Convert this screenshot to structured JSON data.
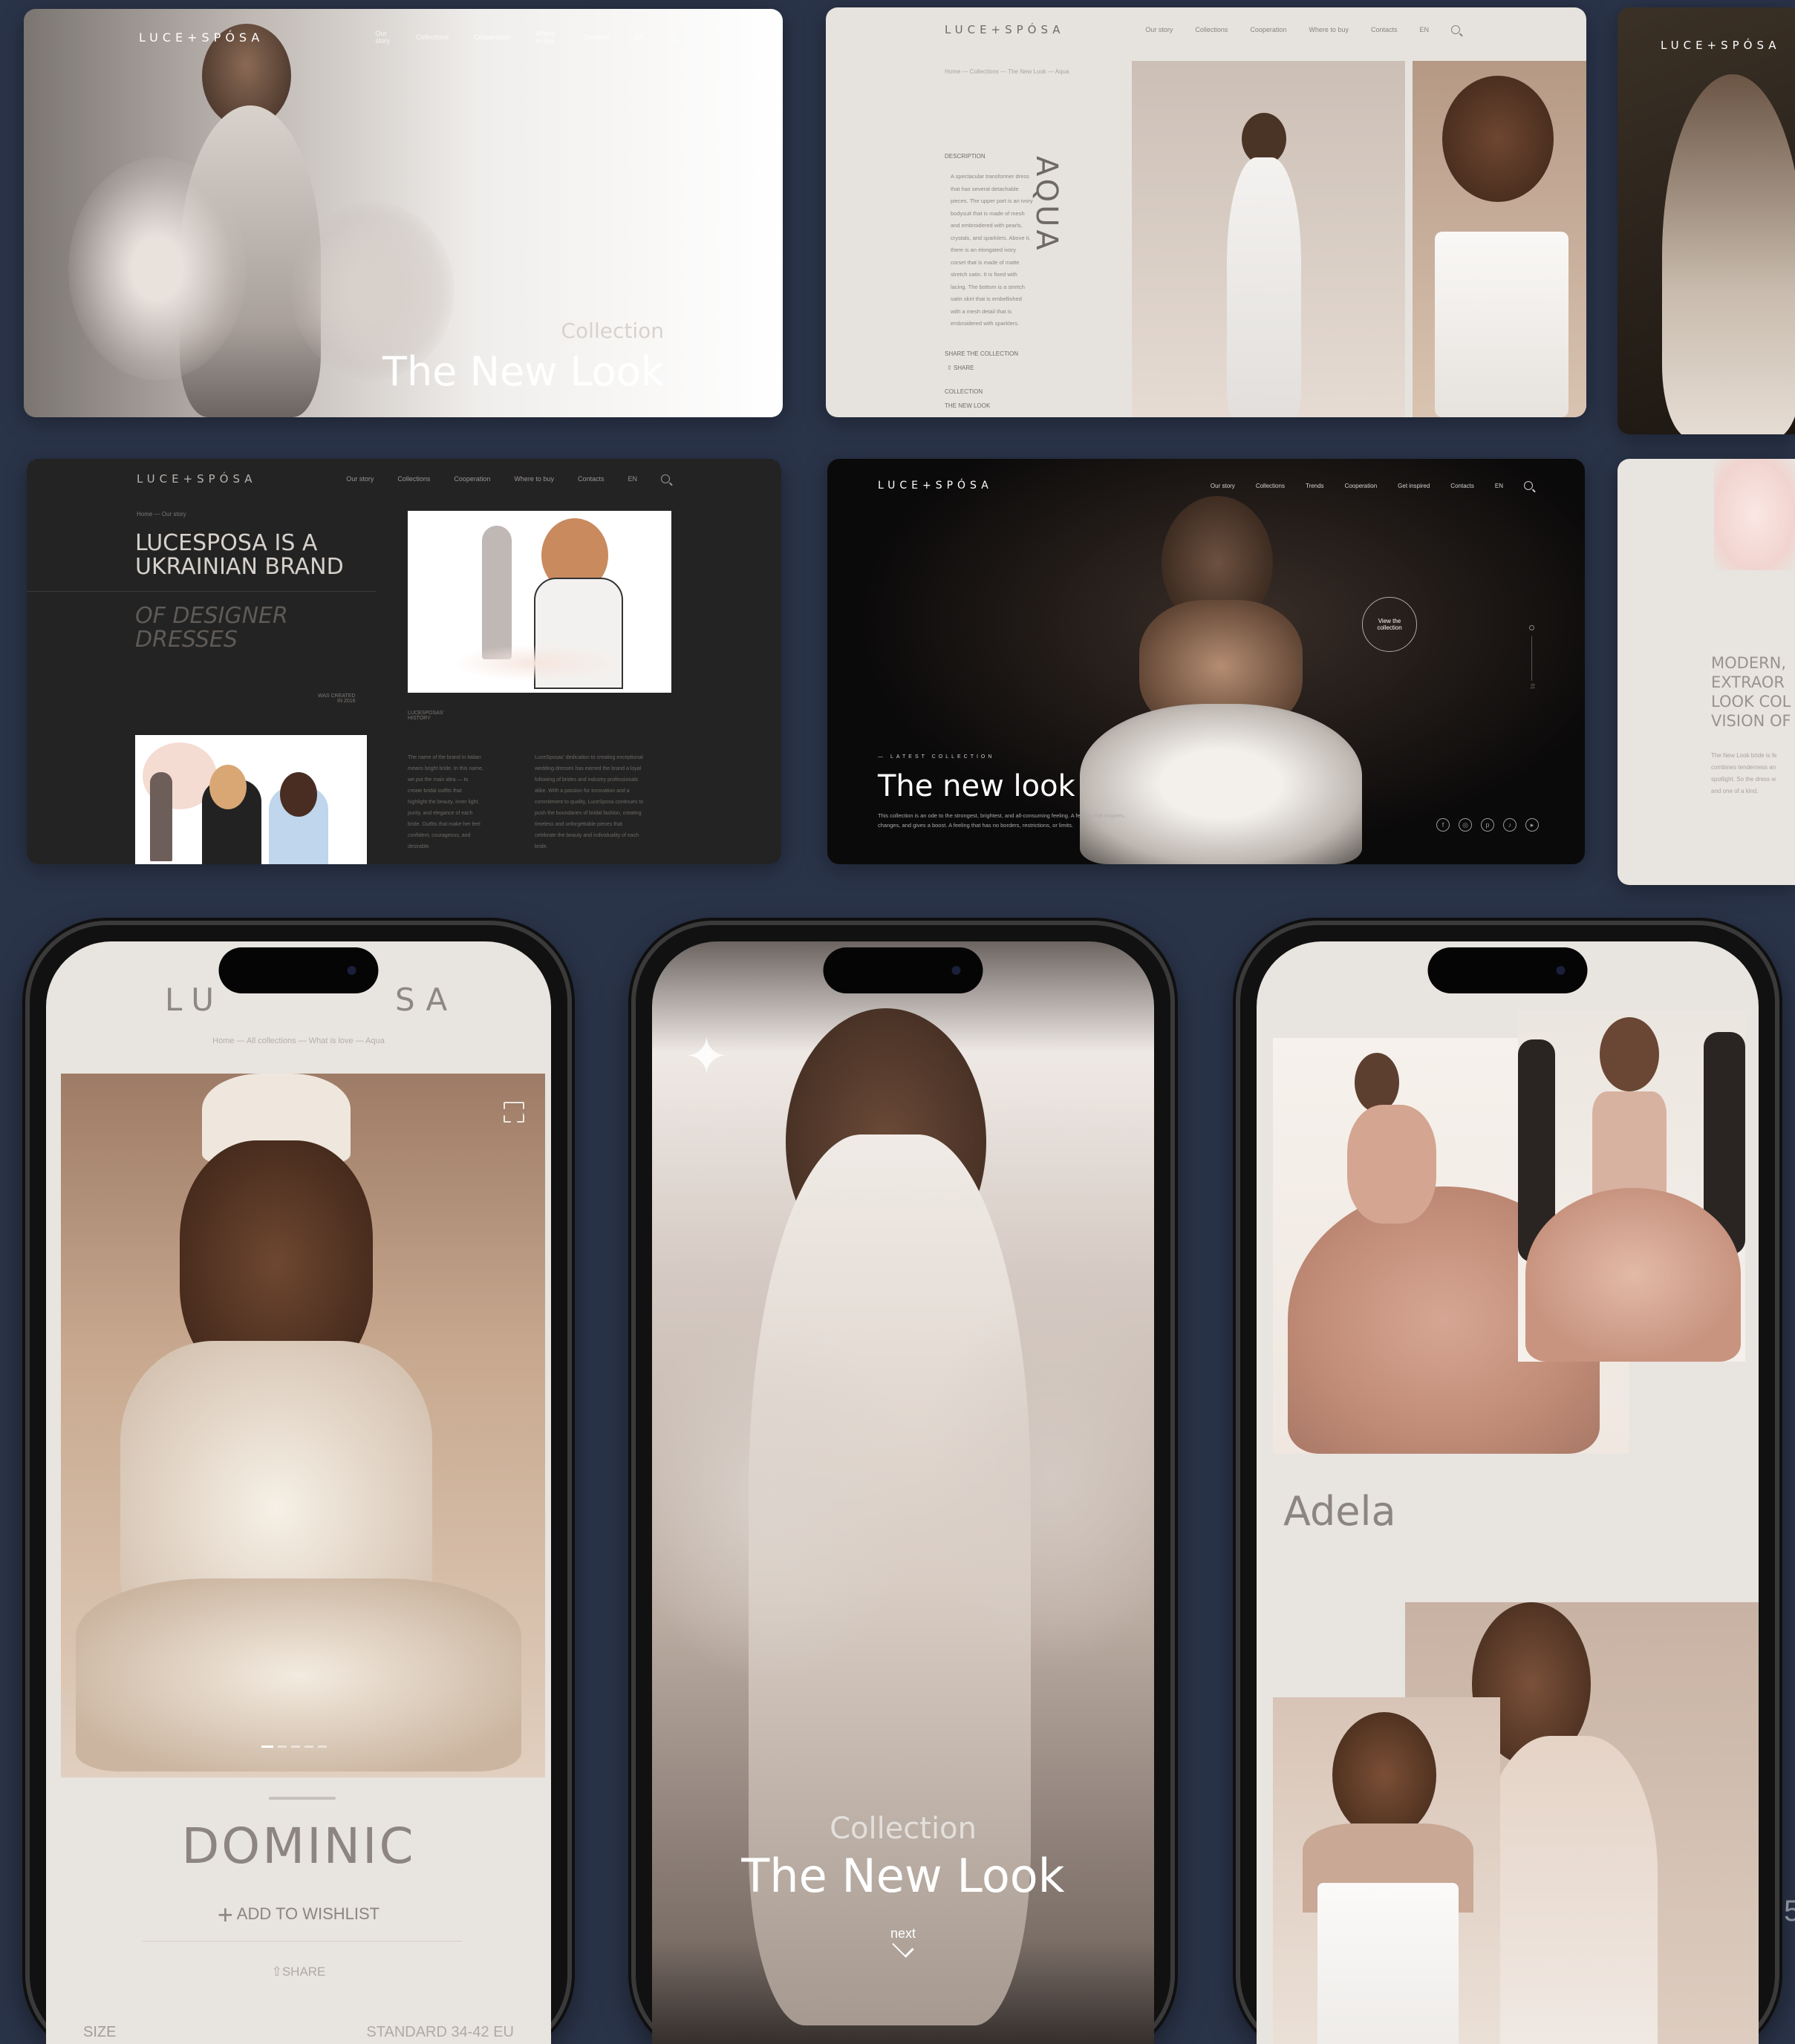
{
  "brand": "LUCE+SPÓSA",
  "nav_main": [
    "Our story",
    "Collections",
    "Cooperation",
    "Where to buy",
    "Contacts",
    "EN"
  ],
  "nav_dark": [
    "Our story",
    "Collections",
    "Trends",
    "Cooperation",
    "Get inspired",
    "Contacts",
    "EN"
  ],
  "card1": {
    "eyebrow": "Collection",
    "title": "The New Look"
  },
  "card2": {
    "breadcrumb": "Home  —  Collections  —  The New Look  —  Aqua",
    "dress_name": "AQUA",
    "desc_label": "DESCRIPTION",
    "desc_lines": [
      "A spectacular transformer dress",
      "that has several detachable",
      "pieces. The upper part is an ivory",
      "bodysuit that is made of mesh",
      "and embroidered with pearls,",
      "crystals, and sparklers. Above it,",
      "there is an elongated ivory",
      "corset that is made of matte",
      "stretch satin. It is fixed with",
      "lacing. The bottom is a stretch",
      "satin skirt that is embellished",
      "with a mesh detail that is",
      "embroidered with sparklers."
    ],
    "share_label": "SHARE THE COLLECTION",
    "share": "SHARE",
    "collection_label": "COLLECTION",
    "collection_value": "THE NEW LOOK"
  },
  "card4": {
    "breadcrumb": "Home  —  Our story",
    "headline_1": "LUCESPOSA IS A",
    "headline_2": "UKRAINIAN BRAND",
    "sub_1": "OF DESIGNER",
    "sub_2": "DRESSES",
    "created_1": "WAS CREATED",
    "created_2": "IN 2016",
    "history_1": "LUCESPOSAS'",
    "history_2": "HISTORY",
    "col1": [
      "The name of the brand in Italian",
      "means bright bride. In this name,",
      "we put the main idea — to",
      "create bridal outfits that",
      "highlight the beauty, inner light,",
      "purity, and elegance of each",
      "bride. Outfits that make her feel",
      "confident, courageous, and",
      "desirable."
    ],
    "col2": [
      "LuceSposas' dedication to creating exceptional",
      "wedding dresses has earned the brand a loyal",
      "following of brides and industry professionals",
      "alike. With a passion for innovation and a",
      "commitment to quality, LuceSposa continues to",
      "push the boundaries of bridal fashion, creating",
      "timeless and unforgettable pieces that",
      "celebrate the beauty and individuality of each",
      "bride."
    ]
  },
  "card5": {
    "eyebrow": "LATEST COLLECTION",
    "title": "The new look",
    "desc_1": "This collection is an ode to the strongest, brightest, and all-consuming feeling. A feeling that inspires,",
    "desc_2": "changes, and gives a boost. A feeling that has no borders, restrictions, or limits.",
    "view_1": "View the",
    "view_2": "collection",
    "counter": "01"
  },
  "card6": {
    "lines": [
      "MODERN,",
      "EXTRAOR",
      "LOOK COL",
      "VISION OF"
    ],
    "small": [
      "The New Look bride is fe",
      "combines tenderness an",
      "spotlight. So the dress w",
      "and one of a kind."
    ]
  },
  "phone1": {
    "brand_left": "LU",
    "brand_right": "SA",
    "breadcrumb": "Home  —  All collections  —  What is love  —  Aqua",
    "dress": "DOMINIC",
    "wishlist": "ADD TO WISHLIST",
    "share": "SHARE",
    "size_label": "SIZE",
    "size_value": "STANDARD 34-42 EU"
  },
  "phone2": {
    "eyebrow": "Collection",
    "title": "The New Look",
    "next": "next"
  },
  "phone3": {
    "name": "Adela"
  },
  "edge_digit": "5",
  "colors": {
    "background": "#2a3449",
    "light_page": "#e8e4df",
    "dark_page": "#1c1c1c"
  }
}
